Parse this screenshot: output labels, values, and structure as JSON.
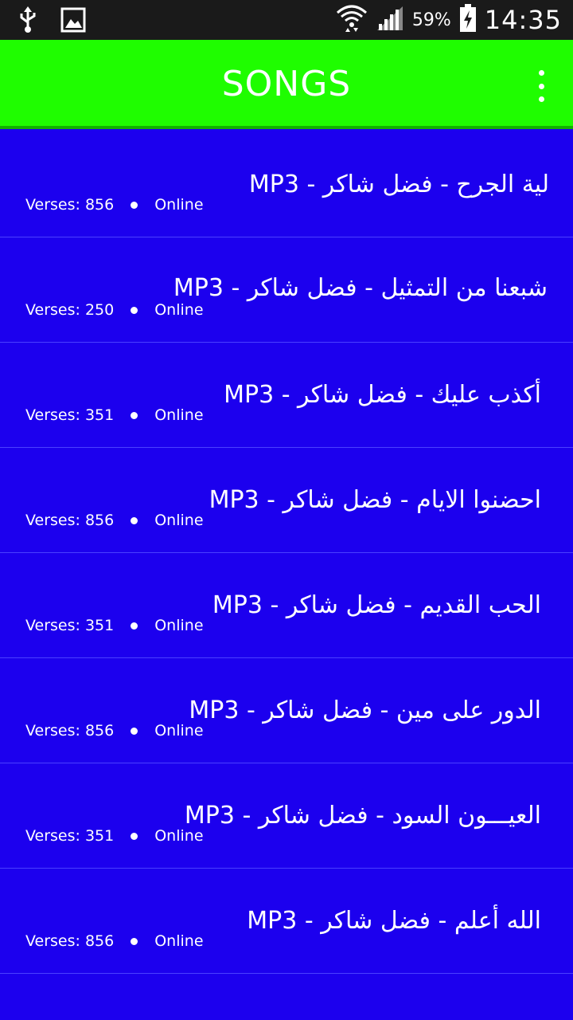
{
  "status_bar": {
    "icons": [
      "usb-icon",
      "image-icon",
      "wifi-icon",
      "signal-icon",
      "battery-icon"
    ],
    "battery": "59%",
    "time": "14:35"
  },
  "app_bar": {
    "title": "SONGS",
    "menu_icon": "overflow-menu-icon",
    "color": "#1ffd00"
  },
  "songs": [
    {
      "title": "لية الجرح - فضل شاكر - MP3",
      "verses": "Verses: 856",
      "status": "Online"
    },
    {
      "title": "شبعنا من التمثيل - فضل شاكر - MP3",
      "verses": "Verses: 250",
      "status": "Online"
    },
    {
      "title": "أكذب عليك - فضل شاكر - MP3",
      "verses": "Verses: 351",
      "status": "Online"
    },
    {
      "title": "احضنوا الايام - فضل شاكر - MP3",
      "verses": "Verses: 856",
      "status": "Online"
    },
    {
      "title": "الحب القديم - فضل شاكر - MP3",
      "verses": "Verses: 351",
      "status": "Online"
    },
    {
      "title": "الدور على مين - فضل شاكر - MP3",
      "verses": "Verses: 856",
      "status": "Online"
    },
    {
      "title": "العيـــون السود - فضل شاكر - MP3",
      "verses": "Verses: 351",
      "status": "Online"
    },
    {
      "title": "الله أعلم - فضل شاكر - MP3",
      "verses": "Verses: 856",
      "status": "Online"
    }
  ],
  "list_background": "#1c00ee"
}
